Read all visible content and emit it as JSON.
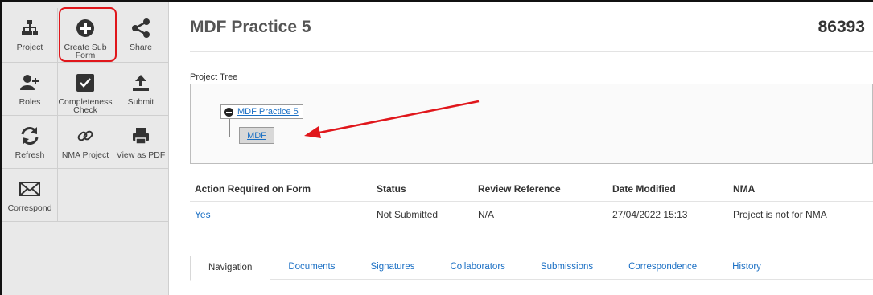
{
  "sidebar": {
    "tiles": [
      {
        "label": "Project",
        "icon": "sitemap-icon"
      },
      {
        "label": "Create Sub Form",
        "icon": "plus-circle-icon"
      },
      {
        "label": "Share",
        "icon": "share-icon"
      },
      {
        "label": "Roles",
        "icon": "add-user-icon"
      },
      {
        "label": "Completeness Check",
        "icon": "checkbox-icon"
      },
      {
        "label": "Submit",
        "icon": "upload-icon"
      },
      {
        "label": "Refresh",
        "icon": "refresh-icon"
      },
      {
        "label": "NMA Project",
        "icon": "link-icon"
      },
      {
        "label": "View as PDF",
        "icon": "print-icon"
      },
      {
        "label": "Correspond",
        "icon": "envelope-icon"
      }
    ],
    "highlight_color": "#e0161b"
  },
  "header": {
    "title": "MDF Practice 5",
    "project_id": "86393"
  },
  "tree": {
    "label": "Project Tree",
    "root": "MDF Practice 5",
    "child": "MDF"
  },
  "table": {
    "headers": [
      "Action Required on Form",
      "Status",
      "Review Reference",
      "Date Modified",
      "NMA"
    ],
    "row": [
      "Yes",
      "Not Submitted",
      "N/A",
      "27/04/2022 15:13",
      "Project is not for NMA"
    ]
  },
  "tabs": [
    "Navigation",
    "Documents",
    "Signatures",
    "Collaborators",
    "Submissions",
    "Correspondence",
    "History"
  ],
  "colors": {
    "link": "#1a6fc4",
    "annotation": "#e0161b"
  }
}
